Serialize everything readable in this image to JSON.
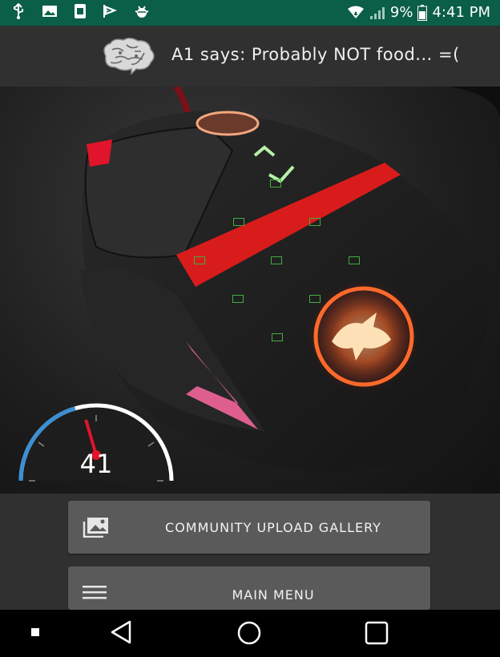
{
  "status_bar": {
    "icons_left": [
      "usb-icon",
      "image-icon",
      "sim-icon",
      "flag-icon",
      "bug-icon"
    ],
    "battery_percent": "9%",
    "time": "4:41 PM"
  },
  "header": {
    "icon": "brain-icon",
    "message": "A1 says: Probably NOT food... =("
  },
  "gauge": {
    "value": "41",
    "level": 0.41
  },
  "buttons": {
    "gallery": {
      "label": "COMMUNITY UPLOAD GALLERY",
      "icon": "gallery-icon"
    },
    "menu": {
      "label": "MAIN MENU",
      "icon": "hamburger-icon"
    }
  },
  "nav": {
    "icons": [
      "recents-dot-icon",
      "back-icon",
      "home-icon",
      "overview-icon"
    ]
  },
  "colors": {
    "status_bar": "#0b5e47",
    "background": "#303030",
    "button": "#5a5a5a",
    "gauge_accent": "#3b8fd6",
    "needle": "#e0142a",
    "detection_box": "#3fae3f"
  }
}
